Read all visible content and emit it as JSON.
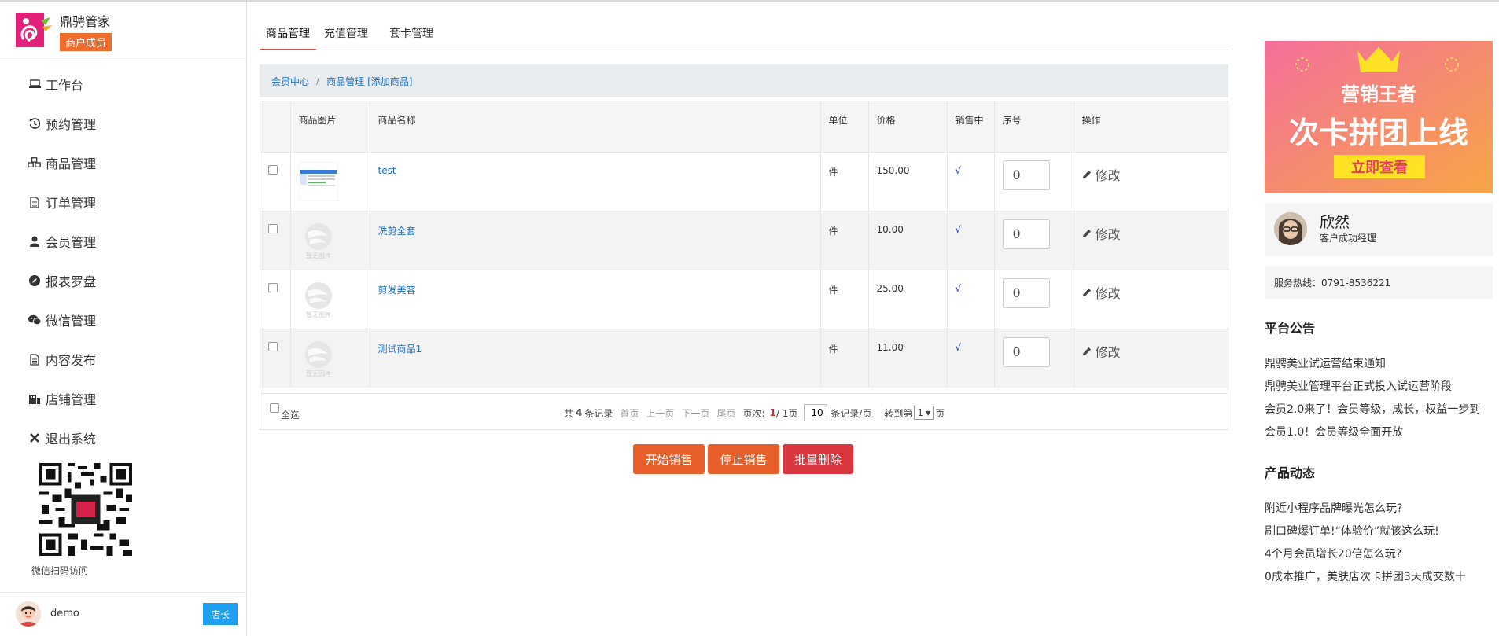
{
  "brand": {
    "name": "鼎骋管家",
    "badge": "商户成员"
  },
  "sidebar": {
    "items": [
      {
        "label": "工作台",
        "icon": "laptop-icon"
      },
      {
        "label": "预约管理",
        "icon": "history-icon"
      },
      {
        "label": "商品管理",
        "icon": "cubes-icon"
      },
      {
        "label": "订单管理",
        "icon": "file-text-icon"
      },
      {
        "label": "会员管理",
        "icon": "user-icon"
      },
      {
        "label": "报表罗盘",
        "icon": "compass-icon"
      },
      {
        "label": "微信管理",
        "icon": "wechat-icon"
      },
      {
        "label": "内容发布",
        "icon": "file-text-icon"
      },
      {
        "label": "店铺管理",
        "icon": "shop-icon"
      },
      {
        "label": "退出系统",
        "icon": "close-icon"
      }
    ],
    "qr_caption": "微信扫码访问"
  },
  "user": {
    "name": "demo",
    "role": "店长"
  },
  "tabs": [
    {
      "label": "商品管理",
      "active": true
    },
    {
      "label": "充值管理",
      "active": false
    },
    {
      "label": "套卡管理",
      "active": false
    }
  ],
  "breadcrumb": {
    "home": "会员中心",
    "sep": "/",
    "current": "商品管理",
    "action": "[添加商品]"
  },
  "table": {
    "headers": [
      "",
      "商品图片",
      "商品名称",
      "单位",
      "价格",
      "销售中",
      "序号",
      "操作"
    ],
    "rows": [
      {
        "image": "screenshot-thumbnail",
        "name": "test",
        "unit": "件",
        "price": "150.00",
        "on_sale": "√",
        "seq": "0",
        "action": "修改"
      },
      {
        "image": "no-image-placeholder",
        "name": "洗剪全套",
        "unit": "件",
        "price": "10.00",
        "on_sale": "√",
        "seq": "0",
        "action": "修改"
      },
      {
        "image": "no-image-placeholder",
        "name": "剪发美容",
        "unit": "件",
        "price": "25.00",
        "on_sale": "√",
        "seq": "0",
        "action": "修改"
      },
      {
        "image": "no-image-placeholder",
        "name": "测试商品1",
        "unit": "件",
        "price": "11.00",
        "on_sale": "√",
        "seq": "0",
        "action": "修改"
      }
    ],
    "no_image_text": "暂无图片"
  },
  "pager": {
    "select_all": "全选",
    "total_prefix": "共",
    "total": "4",
    "total_suffix": "条记录",
    "first": "首页",
    "prev": "上一页",
    "next": "下一页",
    "last": "尾页",
    "page_label": "页次:",
    "current_page": "1",
    "total_pages": "/ 1页",
    "page_size": "10",
    "page_size_suffix": "条记录/页",
    "goto_prefix": "转到第",
    "goto_value": "1",
    "goto_suffix": "页"
  },
  "actions": {
    "start": "开始销售",
    "stop": "停止销售",
    "delete": "批量删除"
  },
  "right": {
    "banner": {
      "line1": "营销王者",
      "line2": "次卡拼团上线",
      "cta": "立即查看"
    },
    "manager": {
      "name": "欣然",
      "title": "客户成功经理"
    },
    "hotline": "服务热线：0791-8536221",
    "announce_title": "平台公告",
    "announcements": [
      "鼎骋美业试运营结束通知",
      "鼎骋美业管理平台正式投入试运营阶段",
      "会员2.0来了！会员等级，成长，权益一步到",
      "会员1.0！会员等级全面开放"
    ],
    "news_title": "产品动态",
    "news": [
      "附近小程序品牌曝光怎么玩?",
      "刷口碑爆订单!“体验价”就该这么玩!",
      "4个月会员增长20倍怎么玩?",
      "0成本推广，美肤店次卡拼团3天成交数十"
    ]
  },
  "colors": {
    "accent_orange": "#e95f2b",
    "danger_red": "#d9363e",
    "link_blue": "#1f6fbf",
    "role_blue": "#1e9ff2"
  }
}
